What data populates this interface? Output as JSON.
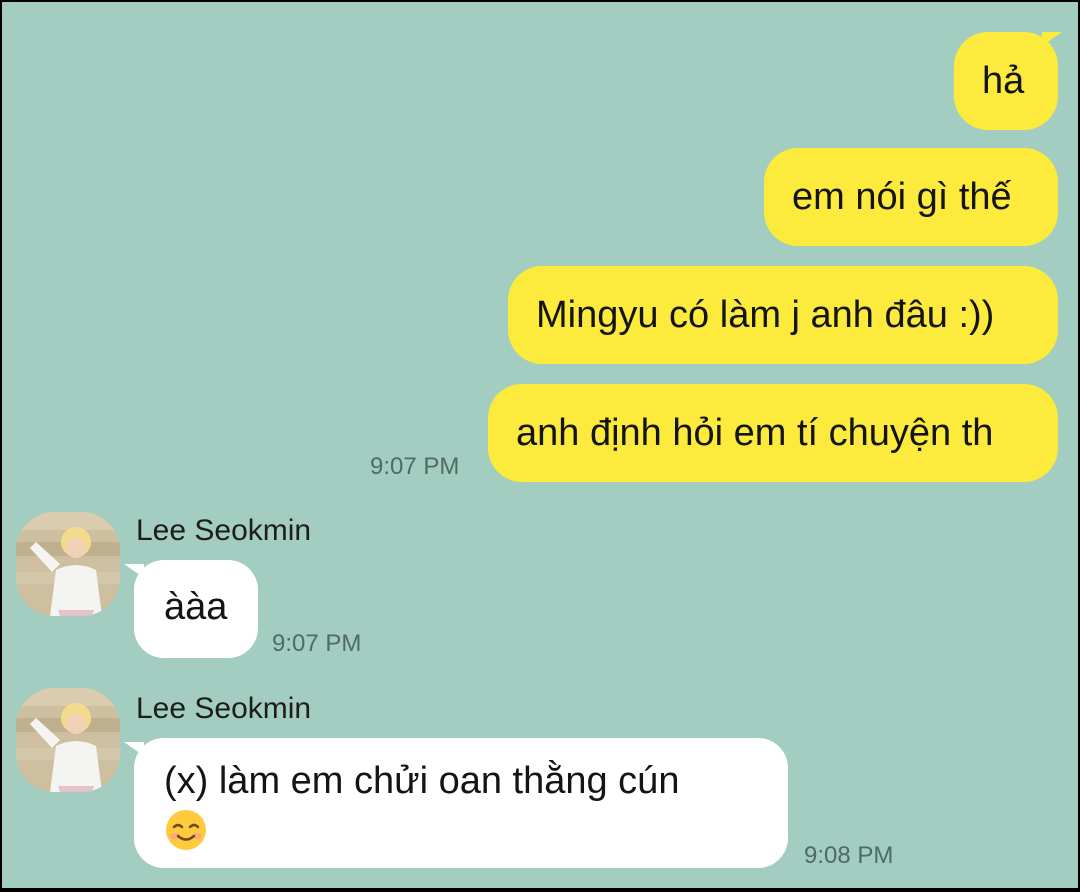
{
  "chat": {
    "outgoing": [
      {
        "text": "hả"
      },
      {
        "text": "em nói gì thế"
      },
      {
        "text": "Mingyu có làm j anh đâu :))"
      },
      {
        "text": "anh định hỏi em tí chuyện th"
      }
    ],
    "outgoing_time": "9:07 PM",
    "incoming": [
      {
        "sender": "Lee Seokmin",
        "text": "ààa",
        "time": "9:07 PM"
      },
      {
        "sender": "Lee Seokmin",
        "text": "(x) làm em chửi oan thằng cún",
        "emoji": "smiling-face-with-smiling-eyes-emoji",
        "time": "9:08 PM"
      }
    ]
  },
  "colors": {
    "background": "#a4cdc1",
    "outgoing_bubble": "#fcea3c",
    "incoming_bubble": "#ffffff",
    "timestamp": "#4f6b63"
  }
}
